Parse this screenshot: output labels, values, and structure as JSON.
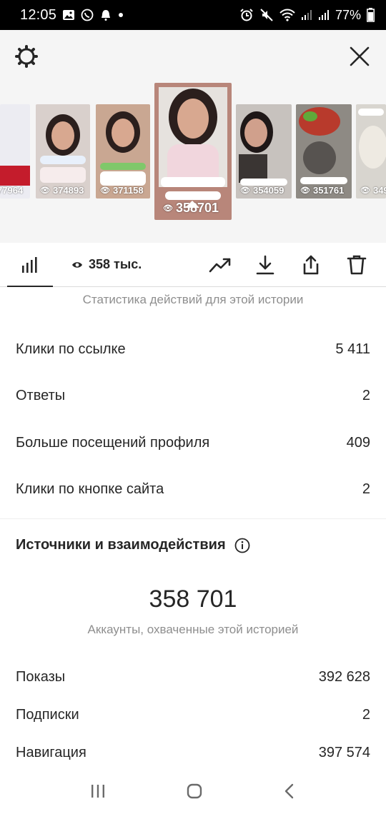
{
  "status_bar": {
    "time": "12:05",
    "battery": "77%"
  },
  "thumbnails": [
    {
      "views": "77964",
      "bg": "#e9e9ef",
      "partial": "left"
    },
    {
      "views": "374893",
      "bg": "#d9d0cc"
    },
    {
      "views": "371158",
      "bg": "#c9a792"
    },
    {
      "views": "358701",
      "bg": "#b8867a",
      "active": true
    },
    {
      "views": "354059",
      "bg": "#c7c2be"
    },
    {
      "views": "351761",
      "bg": "#8e8a84"
    },
    {
      "views": "349",
      "bg": "#d8d5cf",
      "partial": "right"
    }
  ],
  "toolbar": {
    "views_label": "358 тыс."
  },
  "actions_caption": "Статистика действий для этой истории",
  "metrics": [
    {
      "label": "Клики по ссылке",
      "value": "5 411"
    },
    {
      "label": "Ответы",
      "value": "2"
    },
    {
      "label": "Больше посещений профиля",
      "value": "409"
    },
    {
      "label": "Клики по кнопке сайта",
      "value": "2"
    }
  ],
  "sources": {
    "title": "Источники и взаимодействия",
    "reach_value": "358 701",
    "reach_caption": "Аккаунты, охваченные этой историей",
    "rows": [
      {
        "label": "Показы",
        "value": "392 628"
      },
      {
        "label": "Подписки",
        "value": "2"
      },
      {
        "label": "Навигация",
        "value": "397 574"
      }
    ]
  }
}
